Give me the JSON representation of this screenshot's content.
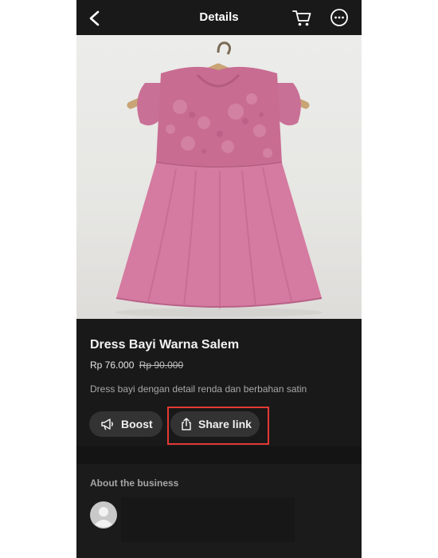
{
  "header": {
    "title": "Details",
    "back_icon": "chevron-left-icon",
    "cart_icon": "cart-icon",
    "more_icon": "more-horizontal-icon"
  },
  "product": {
    "image": "pink-dress-on-hanger",
    "name": "Dress Bayi Warna Salem",
    "price": "Rp 76.000",
    "original_price": "Rp 90.000",
    "description": "Dress bayi dengan detail renda dan berbahan satin"
  },
  "actions": {
    "boost_label": "Boost",
    "boost_icon": "megaphone-icon",
    "share_label": "Share link",
    "share_icon": "share-icon",
    "highlight_color": "#e53935"
  },
  "business": {
    "heading": "About the business",
    "avatar_icon": "user-avatar-icon"
  }
}
